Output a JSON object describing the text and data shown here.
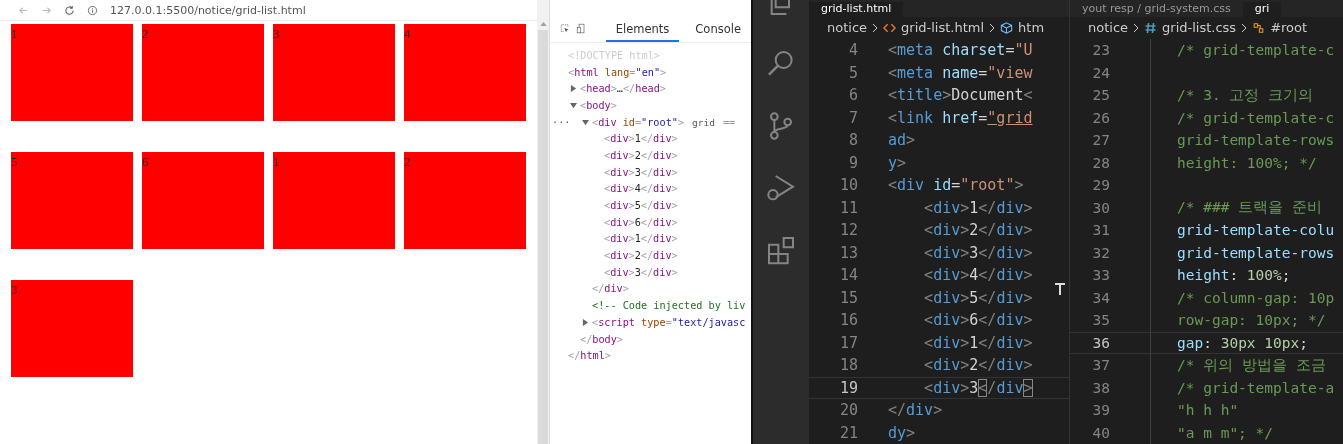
{
  "browser": {
    "url": "127.0.0.1:5500/notice/grid-list.html",
    "grid_items": [
      {
        "label": "1"
      },
      {
        "label": "2"
      },
      {
        "label": "3"
      },
      {
        "label": "4"
      },
      {
        "label": "5"
      },
      {
        "label": "6"
      },
      {
        "label": "1"
      },
      {
        "label": "2"
      },
      {
        "label": "3"
      }
    ]
  },
  "devtools": {
    "tabs": [
      {
        "label": "Elements",
        "selected": true
      },
      {
        "label": "Console",
        "selected": false
      }
    ],
    "tree": [
      {
        "open": [
          {
            "kind": "doctype",
            "text": "<!DOCTYPE html>"
          }
        ]
      },
      {
        "open": [
          {
            "kind": "punct",
            "text": "<"
          },
          {
            "kind": "tag",
            "text": "html"
          },
          {
            "kind": "attr",
            "text": " lang"
          },
          {
            "kind": "punct",
            "text": "="
          },
          {
            "kind": "str",
            "text": "\"en\""
          },
          {
            "kind": "punct",
            "text": ">"
          }
        ],
        "children": [
          {
            "expanded": false,
            "open": [
              {
                "kind": "punct",
                "text": "<"
              },
              {
                "kind": "tag",
                "text": "head"
              },
              {
                "kind": "punct",
                "text": ">"
              },
              {
                "kind": "text",
                "text": "…"
              },
              {
                "kind": "punct",
                "text": "</"
              },
              {
                "kind": "tag",
                "text": "head"
              },
              {
                "kind": "punct",
                "text": ">"
              }
            ]
          },
          {
            "expanded": true,
            "open": [
              {
                "kind": "punct",
                "text": "<"
              },
              {
                "kind": "tag",
                "text": "body"
              },
              {
                "kind": "punct",
                "text": ">"
              }
            ],
            "children": [
              {
                "expanded": true,
                "prefix": "···",
                "badge": "grid",
                "suffix": "==",
                "open": [
                  {
                    "kind": "punct",
                    "text": "<"
                  },
                  {
                    "kind": "tag",
                    "text": "div"
                  },
                  {
                    "kind": "attr",
                    "text": " id"
                  },
                  {
                    "kind": "punct",
                    "text": "="
                  },
                  {
                    "kind": "str",
                    "text": "\"root\""
                  },
                  {
                    "kind": "punct",
                    "text": ">"
                  }
                ],
                "children": [
                  {
                    "open": [
                      {
                        "kind": "punct",
                        "text": "<"
                      },
                      {
                        "kind": "tag",
                        "text": "div"
                      },
                      {
                        "kind": "punct",
                        "text": ">"
                      },
                      {
                        "kind": "text",
                        "text": "1"
                      },
                      {
                        "kind": "punct",
                        "text": "</"
                      },
                      {
                        "kind": "tag",
                        "text": "div"
                      },
                      {
                        "kind": "punct",
                        "text": ">"
                      }
                    ]
                  },
                  {
                    "open": [
                      {
                        "kind": "punct",
                        "text": "<"
                      },
                      {
                        "kind": "tag",
                        "text": "div"
                      },
                      {
                        "kind": "punct",
                        "text": ">"
                      },
                      {
                        "kind": "text",
                        "text": "2"
                      },
                      {
                        "kind": "punct",
                        "text": "</"
                      },
                      {
                        "kind": "tag",
                        "text": "div"
                      },
                      {
                        "kind": "punct",
                        "text": ">"
                      }
                    ]
                  },
                  {
                    "open": [
                      {
                        "kind": "punct",
                        "text": "<"
                      },
                      {
                        "kind": "tag",
                        "text": "div"
                      },
                      {
                        "kind": "punct",
                        "text": ">"
                      },
                      {
                        "kind": "text",
                        "text": "3"
                      },
                      {
                        "kind": "punct",
                        "text": "</"
                      },
                      {
                        "kind": "tag",
                        "text": "div"
                      },
                      {
                        "kind": "punct",
                        "text": ">"
                      }
                    ]
                  },
                  {
                    "open": [
                      {
                        "kind": "punct",
                        "text": "<"
                      },
                      {
                        "kind": "tag",
                        "text": "div"
                      },
                      {
                        "kind": "punct",
                        "text": ">"
                      },
                      {
                        "kind": "text",
                        "text": "4"
                      },
                      {
                        "kind": "punct",
                        "text": "</"
                      },
                      {
                        "kind": "tag",
                        "text": "div"
                      },
                      {
                        "kind": "punct",
                        "text": ">"
                      }
                    ]
                  },
                  {
                    "open": [
                      {
                        "kind": "punct",
                        "text": "<"
                      },
                      {
                        "kind": "tag",
                        "text": "div"
                      },
                      {
                        "kind": "punct",
                        "text": ">"
                      },
                      {
                        "kind": "text",
                        "text": "5"
                      },
                      {
                        "kind": "punct",
                        "text": "</"
                      },
                      {
                        "kind": "tag",
                        "text": "div"
                      },
                      {
                        "kind": "punct",
                        "text": ">"
                      }
                    ]
                  },
                  {
                    "open": [
                      {
                        "kind": "punct",
                        "text": "<"
                      },
                      {
                        "kind": "tag",
                        "text": "div"
                      },
                      {
                        "kind": "punct",
                        "text": ">"
                      },
                      {
                        "kind": "text",
                        "text": "6"
                      },
                      {
                        "kind": "punct",
                        "text": "</"
                      },
                      {
                        "kind": "tag",
                        "text": "div"
                      },
                      {
                        "kind": "punct",
                        "text": ">"
                      }
                    ]
                  },
                  {
                    "open": [
                      {
                        "kind": "punct",
                        "text": "<"
                      },
                      {
                        "kind": "tag",
                        "text": "div"
                      },
                      {
                        "kind": "punct",
                        "text": ">"
                      },
                      {
                        "kind": "text",
                        "text": "1"
                      },
                      {
                        "kind": "punct",
                        "text": "</"
                      },
                      {
                        "kind": "tag",
                        "text": "div"
                      },
                      {
                        "kind": "punct",
                        "text": ">"
                      }
                    ]
                  },
                  {
                    "open": [
                      {
                        "kind": "punct",
                        "text": "<"
                      },
                      {
                        "kind": "tag",
                        "text": "div"
                      },
                      {
                        "kind": "punct",
                        "text": ">"
                      },
                      {
                        "kind": "text",
                        "text": "2"
                      },
                      {
                        "kind": "punct",
                        "text": "</"
                      },
                      {
                        "kind": "tag",
                        "text": "div"
                      },
                      {
                        "kind": "punct",
                        "text": ">"
                      }
                    ]
                  },
                  {
                    "open": [
                      {
                        "kind": "punct",
                        "text": "<"
                      },
                      {
                        "kind": "tag",
                        "text": "div"
                      },
                      {
                        "kind": "punct",
                        "text": ">"
                      },
                      {
                        "kind": "text",
                        "text": "3"
                      },
                      {
                        "kind": "punct",
                        "text": "</"
                      },
                      {
                        "kind": "tag",
                        "text": "div"
                      },
                      {
                        "kind": "punct",
                        "text": ">"
                      }
                    ]
                  }
                ],
                "close": [
                  {
                    "kind": "punct",
                    "text": "</"
                  },
                  {
                    "kind": "tag",
                    "text": "div"
                  },
                  {
                    "kind": "punct",
                    "text": ">"
                  }
                ]
              },
              {
                "open": [
                  {
                    "kind": "comment",
                    "text": "<!-- Code injected by liv"
                  }
                ]
              },
              {
                "expanded": false,
                "open": [
                  {
                    "kind": "punct",
                    "text": "<"
                  },
                  {
                    "kind": "tag",
                    "text": "script"
                  },
                  {
                    "kind": "attr",
                    "text": " type"
                  },
                  {
                    "kind": "punct",
                    "text": "="
                  },
                  {
                    "kind": "str",
                    "text": "\"text/javasc"
                  }
                ]
              }
            ],
            "close": [
              {
                "kind": "punct",
                "text": "</"
              },
              {
                "kind": "tag",
                "text": "body"
              },
              {
                "kind": "punct",
                "text": ">"
              }
            ]
          }
        ],
        "close": [
          {
            "kind": "punct",
            "text": "</"
          },
          {
            "kind": "tag",
            "text": "html"
          },
          {
            "kind": "punct",
            "text": ">"
          }
        ]
      }
    ]
  },
  "editors": [
    {
      "tabs": [
        {
          "label": "grid-list.html",
          "selected": true
        }
      ],
      "breadcrumb": [
        {
          "kind": "folder",
          "text": "notice"
        },
        {
          "kind": "html-file",
          "text": "grid-list.html"
        },
        {
          "kind": "element",
          "text": "htm"
        }
      ],
      "lines": [
        {
          "number": "4",
          "current": false,
          "tokens": [
            {
              "kind": "punct",
              "text": "<"
            },
            {
              "kind": "tag",
              "text": "meta"
            },
            {
              "kind": "attr",
              "text": " charset"
            },
            {
              "kind": "text",
              "text": "="
            },
            {
              "kind": "str",
              "text": "\"U"
            }
          ]
        },
        {
          "number": "5",
          "current": false,
          "tokens": [
            {
              "kind": "punct",
              "text": "<"
            },
            {
              "kind": "tag",
              "text": "meta"
            },
            {
              "kind": "attr",
              "text": " name"
            },
            {
              "kind": "text",
              "text": "="
            },
            {
              "kind": "str",
              "text": "\"view"
            }
          ]
        },
        {
          "number": "6",
          "current": false,
          "tokens": [
            {
              "kind": "punct",
              "text": "<"
            },
            {
              "kind": "tag",
              "text": "title"
            },
            {
              "kind": "punct",
              "text": ">"
            },
            {
              "kind": "text",
              "text": "Document"
            },
            {
              "kind": "punct",
              "text": "<"
            }
          ]
        },
        {
          "number": "7",
          "current": false,
          "tokens": [
            {
              "kind": "punct",
              "text": "<"
            },
            {
              "kind": "tag",
              "text": "link"
            },
            {
              "kind": "attr",
              "text": " href"
            },
            {
              "kind": "text",
              "text": "="
            },
            {
              "kind": "link",
              "text": "\"grid"
            }
          ]
        },
        {
          "number": "8",
          "current": false,
          "tokens": [
            {
              "kind": "tag",
              "text": "ad"
            },
            {
              "kind": "punct",
              "text": ">"
            }
          ]
        },
        {
          "number": "9",
          "current": false,
          "tokens": [
            {
              "kind": "tag",
              "text": "y"
            },
            {
              "kind": "punct",
              "text": ">"
            }
          ]
        },
        {
          "number": "10",
          "current": false,
          "tokens": [
            {
              "kind": "punct",
              "text": "<"
            },
            {
              "kind": "tag",
              "text": "div"
            },
            {
              "kind": "attr",
              "text": " id"
            },
            {
              "kind": "text",
              "text": "="
            },
            {
              "kind": "str",
              "text": "\"root\""
            },
            {
              "kind": "punct",
              "text": ">"
            }
          ]
        },
        {
          "number": "11",
          "current": false,
          "tokens": [
            {
              "kind": "punct",
              "text": "    <"
            },
            {
              "kind": "tag",
              "text": "div"
            },
            {
              "kind": "punct",
              "text": ">"
            },
            {
              "kind": "text",
              "text": "1"
            },
            {
              "kind": "punct",
              "text": "</"
            },
            {
              "kind": "tag",
              "text": "div"
            },
            {
              "kind": "punct",
              "text": ">"
            }
          ]
        },
        {
          "number": "12",
          "current": false,
          "tokens": [
            {
              "kind": "punct",
              "text": "    <"
            },
            {
              "kind": "tag",
              "text": "div"
            },
            {
              "kind": "punct",
              "text": ">"
            },
            {
              "kind": "text",
              "text": "2"
            },
            {
              "kind": "punct",
              "text": "</"
            },
            {
              "kind": "tag",
              "text": "div"
            },
            {
              "kind": "punct",
              "text": ">"
            }
          ]
        },
        {
          "number": "13",
          "current": false,
          "tokens": [
            {
              "kind": "punct",
              "text": "    <"
            },
            {
              "kind": "tag",
              "text": "div"
            },
            {
              "kind": "punct",
              "text": ">"
            },
            {
              "kind": "text",
              "text": "3"
            },
            {
              "kind": "punct",
              "text": "</"
            },
            {
              "kind": "tag",
              "text": "div"
            },
            {
              "kind": "punct",
              "text": ">"
            }
          ]
        },
        {
          "number": "14",
          "current": false,
          "tokens": [
            {
              "kind": "punct",
              "text": "    <"
            },
            {
              "kind": "tag",
              "text": "div"
            },
            {
              "kind": "punct",
              "text": ">"
            },
            {
              "kind": "text",
              "text": "4"
            },
            {
              "kind": "punct",
              "text": "</"
            },
            {
              "kind": "tag",
              "text": "div"
            },
            {
              "kind": "punct",
              "text": ">"
            }
          ]
        },
        {
          "number": "15",
          "current": false,
          "tokens": [
            {
              "kind": "punct",
              "text": "    <"
            },
            {
              "kind": "tag",
              "text": "div"
            },
            {
              "kind": "punct",
              "text": ">"
            },
            {
              "kind": "text",
              "text": "5"
            },
            {
              "kind": "punct",
              "text": "</"
            },
            {
              "kind": "tag",
              "text": "div"
            },
            {
              "kind": "punct",
              "text": ">"
            }
          ]
        },
        {
          "number": "16",
          "current": false,
          "tokens": [
            {
              "kind": "punct",
              "text": "    <"
            },
            {
              "kind": "tag",
              "text": "div"
            },
            {
              "kind": "punct",
              "text": ">"
            },
            {
              "kind": "text",
              "text": "6"
            },
            {
              "kind": "punct",
              "text": "</"
            },
            {
              "kind": "tag",
              "text": "div"
            },
            {
              "kind": "punct",
              "text": ">"
            }
          ]
        },
        {
          "number": "17",
          "current": false,
          "tokens": [
            {
              "kind": "punct",
              "text": "    <"
            },
            {
              "kind": "tag",
              "text": "div"
            },
            {
              "kind": "punct",
              "text": ">"
            },
            {
              "kind": "text",
              "text": "1"
            },
            {
              "kind": "punct",
              "text": "</"
            },
            {
              "kind": "tag",
              "text": "div"
            },
            {
              "kind": "punct",
              "text": ">"
            }
          ]
        },
        {
          "number": "18",
          "current": false,
          "tokens": [
            {
              "kind": "punct",
              "text": "    <"
            },
            {
              "kind": "tag",
              "text": "div"
            },
            {
              "kind": "punct",
              "text": ">"
            },
            {
              "kind": "text",
              "text": "2"
            },
            {
              "kind": "punct",
              "text": "</"
            },
            {
              "kind": "tag",
              "text": "div"
            },
            {
              "kind": "punct",
              "text": ">"
            }
          ]
        },
        {
          "number": "19",
          "current": true,
          "tokens": [
            {
              "kind": "punct",
              "text": "    <"
            },
            {
              "kind": "tag",
              "text": "div"
            },
            {
              "kind": "punct",
              "text": ">"
            },
            {
              "kind": "text",
              "text": "3"
            },
            {
              "kind": "bracket",
              "text": "<"
            },
            {
              "kind": "punct",
              "text": "/"
            },
            {
              "kind": "tag",
              "text": "div"
            },
            {
              "kind": "bracket",
              "text": ">"
            }
          ]
        },
        {
          "number": "20",
          "current": false,
          "tokens": [
            {
              "kind": "punct",
              "text": "</"
            },
            {
              "kind": "tag",
              "text": "div"
            },
            {
              "kind": "punct",
              "text": ">"
            }
          ]
        },
        {
          "number": "21",
          "current": false,
          "tokens": [
            {
              "kind": "tag",
              "text": "dy"
            },
            {
              "kind": "punct",
              "text": ">"
            }
          ]
        }
      ]
    },
    {
      "tabs": [
        {
          "label": "yout resp / grid-system.css",
          "selected": false
        },
        {
          "label": "gri",
          "selected": true
        }
      ],
      "breadcrumb": [
        {
          "kind": "folder",
          "text": "notice"
        },
        {
          "kind": "css-file",
          "text": "grid-list.css"
        },
        {
          "kind": "selector",
          "text": "#root"
        }
      ],
      "lines": [
        {
          "number": "23",
          "current": false,
          "tokens": [
            {
              "kind": "comment",
              "text": "/* grid-template-c"
            }
          ]
        },
        {
          "number": "24",
          "current": false
        },
        {
          "number": "25",
          "current": false,
          "tokens": [
            {
              "kind": "comment",
              "text": "/* 3. 고정 크기의"
            }
          ]
        },
        {
          "number": "26",
          "current": false,
          "tokens": [
            {
              "kind": "comment",
              "text": "/* grid-template-c"
            }
          ]
        },
        {
          "number": "27",
          "current": false,
          "tokens": [
            {
              "kind": "comment",
              "text": "grid-template-rows"
            }
          ]
        },
        {
          "number": "28",
          "current": false,
          "tokens": [
            {
              "kind": "comment",
              "text": "height: 100%; */"
            }
          ]
        },
        {
          "number": "29",
          "current": false
        },
        {
          "number": "30",
          "current": false,
          "tokens": [
            {
              "kind": "comment",
              "text": "/* ### 트랙을 준비"
            }
          ]
        },
        {
          "number": "31",
          "current": false,
          "tokens": [
            {
              "kind": "attr",
              "text": "grid-template-colu"
            }
          ]
        },
        {
          "number": "32",
          "current": false,
          "tokens": [
            {
              "kind": "attr",
              "text": "grid-template-rows"
            }
          ]
        },
        {
          "number": "33",
          "current": false,
          "tokens": [
            {
              "kind": "attr",
              "text": "height"
            },
            {
              "kind": "text",
              "text": ": "
            },
            {
              "kind": "num",
              "text": "100%"
            },
            {
              "kind": "text",
              "text": ";"
            }
          ]
        },
        {
          "number": "34",
          "current": false,
          "tokens": [
            {
              "kind": "comment",
              "text": "/* column-gap: 10p"
            }
          ]
        },
        {
          "number": "35",
          "current": false,
          "tokens": [
            {
              "kind": "comment",
              "text": "row-gap: 10px; */"
            }
          ]
        },
        {
          "number": "36",
          "current": true,
          "tokens": [
            {
              "kind": "attr",
              "text": "gap"
            },
            {
              "kind": "text",
              "text": ": "
            },
            {
              "kind": "num",
              "text": "30px 10px"
            },
            {
              "kind": "text",
              "text": ";"
            }
          ]
        },
        {
          "number": "37",
          "current": false,
          "tokens": [
            {
              "kind": "comment",
              "text": "/* 위의 방법을 조금"
            }
          ]
        },
        {
          "number": "38",
          "current": false,
          "tokens": [
            {
              "kind": "comment",
              "text": "/* grid-template-a"
            }
          ]
        },
        {
          "number": "39",
          "current": false,
          "tokens": [
            {
              "kind": "comment",
              "text": "\"h h h\""
            }
          ]
        },
        {
          "number": "40",
          "current": false,
          "tokens": [
            {
              "kind": "comment",
              "text": "\"a m m\"; */"
            }
          ]
        }
      ]
    }
  ]
}
